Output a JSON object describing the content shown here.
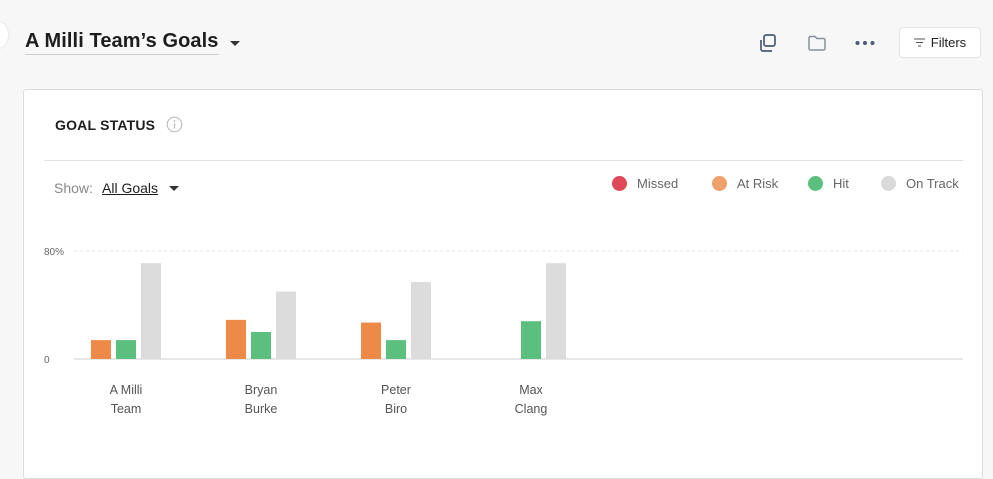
{
  "header": {
    "title": "A Milli Team’s Goals",
    "filters_label": "Filters"
  },
  "card": {
    "title": "GOAL STATUS",
    "show_label": "Show:",
    "show_value": "All Goals"
  },
  "legend": [
    {
      "label": "Missed",
      "color": "#e0485a"
    },
    {
      "label": "At Risk",
      "color": "#f0a06a"
    },
    {
      "label": "Hit",
      "color": "#5bbf7e"
    },
    {
      "label": "On Track",
      "color": "#dadada"
    }
  ],
  "chart_data": {
    "type": "bar",
    "categories": [
      [
        "A Milli",
        "Team"
      ],
      [
        "Bryan",
        "Burke"
      ],
      [
        "Peter",
        "Biro"
      ],
      [
        "Max",
        "Clang"
      ]
    ],
    "series": [
      {
        "name": "Missed",
        "color": "#e0485a",
        "values": [
          0,
          0,
          0,
          0
        ]
      },
      {
        "name": "At Risk",
        "color": "#ee8a48",
        "values": [
          14,
          29,
          27,
          0
        ]
      },
      {
        "name": "Hit",
        "color": "#5bbf7e",
        "values": [
          14,
          20,
          14,
          28
        ]
      },
      {
        "name": "On Track",
        "color": "#dcdcdc",
        "values": [
          71,
          50,
          57,
          71
        ]
      }
    ],
    "ylim": [
      0,
      80
    ],
    "yticks": [
      {
        "value": 0,
        "label": "0"
      },
      {
        "value": 80,
        "label": "80%"
      }
    ]
  }
}
